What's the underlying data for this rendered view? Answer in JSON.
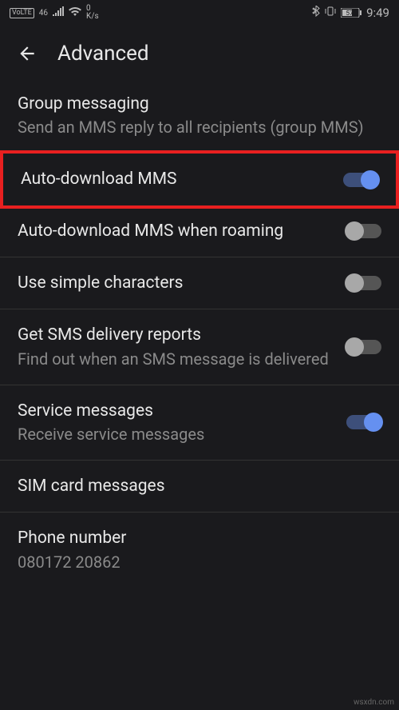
{
  "status": {
    "volte": "VoLTE",
    "signal": "46",
    "speed_top": "0",
    "speed_unit": "K/s",
    "battery": "57",
    "time": "9:49"
  },
  "header": {
    "title": "Advanced"
  },
  "settings": {
    "group_messaging": {
      "title": "Group messaging",
      "subtitle": "Send an MMS reply to all recipients (group MMS)"
    },
    "auto_download_mms": {
      "title": "Auto-download MMS"
    },
    "auto_download_roaming": {
      "title": "Auto-download MMS when roaming"
    },
    "simple_chars": {
      "title": "Use simple characters"
    },
    "delivery_reports": {
      "title": "Get SMS delivery reports",
      "subtitle": "Find out when an SMS message is delivered"
    },
    "service_messages": {
      "title": "Service messages",
      "subtitle": "Receive service messages"
    },
    "sim_card": {
      "title": "SIM card messages"
    },
    "phone_number": {
      "title": "Phone number",
      "subtitle": "080172 20862"
    }
  },
  "watermark": "wsxdn.com"
}
